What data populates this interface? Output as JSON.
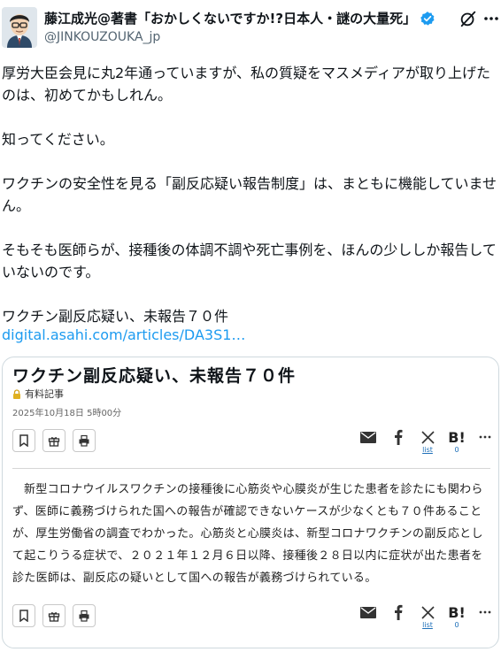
{
  "author": {
    "name": "藤江成光@著書「おかしくないですか!?日本人・謎の大量死」",
    "handle": "@JINKOUZOUKA_jp"
  },
  "tweet": {
    "paragraphs": [
      "厚労大臣会見に丸2年通っていますが、私の質疑をマスメディアが取り上げたのは、初めてかもしれん。",
      "知ってください。",
      "ワクチンの安全性を見る「副反応疑い報告制度」は、まともに機能していません。",
      "そもそも医師らが、接種後の体調不調や死亡事例を、ほんの少ししか報告していないのです。",
      "ワクチン副反応疑い、未報告７０件"
    ],
    "link": "digital.asahi.com/articles/DA3S1…"
  },
  "article": {
    "title": "ワクチン副反応疑い、未報告７０件",
    "paid_label": "有料記事",
    "date": "2025年10月18日 5時00分",
    "share": {
      "x_sub": "list",
      "hatena_label": "B!",
      "hatena_sub": "0"
    },
    "body": "新型コロナウイルスワクチンの接種後に心筋炎や心膜炎が生じた患者を診たにも関わらず、医師に義務づけられた国への報告が確認できないケースが少なくとも７０件あることが、厚生労働省の調査でわかった。心筋炎と心膜炎は、新型コロナワクチンの副反応として起こりうる症状で、２０２１年１２月６日以降、接種後２８日以内に症状が出た患者を診た医師は、副反応の疑いとして国への報告が義務づけられている。"
  },
  "colors": {
    "link": "#1d9bf0",
    "verified": "#1d9bf0",
    "text": "#0f1419",
    "secondary": "#536471"
  },
  "icons": [
    "grok-icon",
    "more-icon",
    "verified-badge-icon",
    "lock-icon",
    "bookmark-icon",
    "gift-icon",
    "print-icon",
    "mail-icon",
    "facebook-icon",
    "x-icon",
    "hatena-bookmark-icon",
    "ellipsis-icon"
  ]
}
